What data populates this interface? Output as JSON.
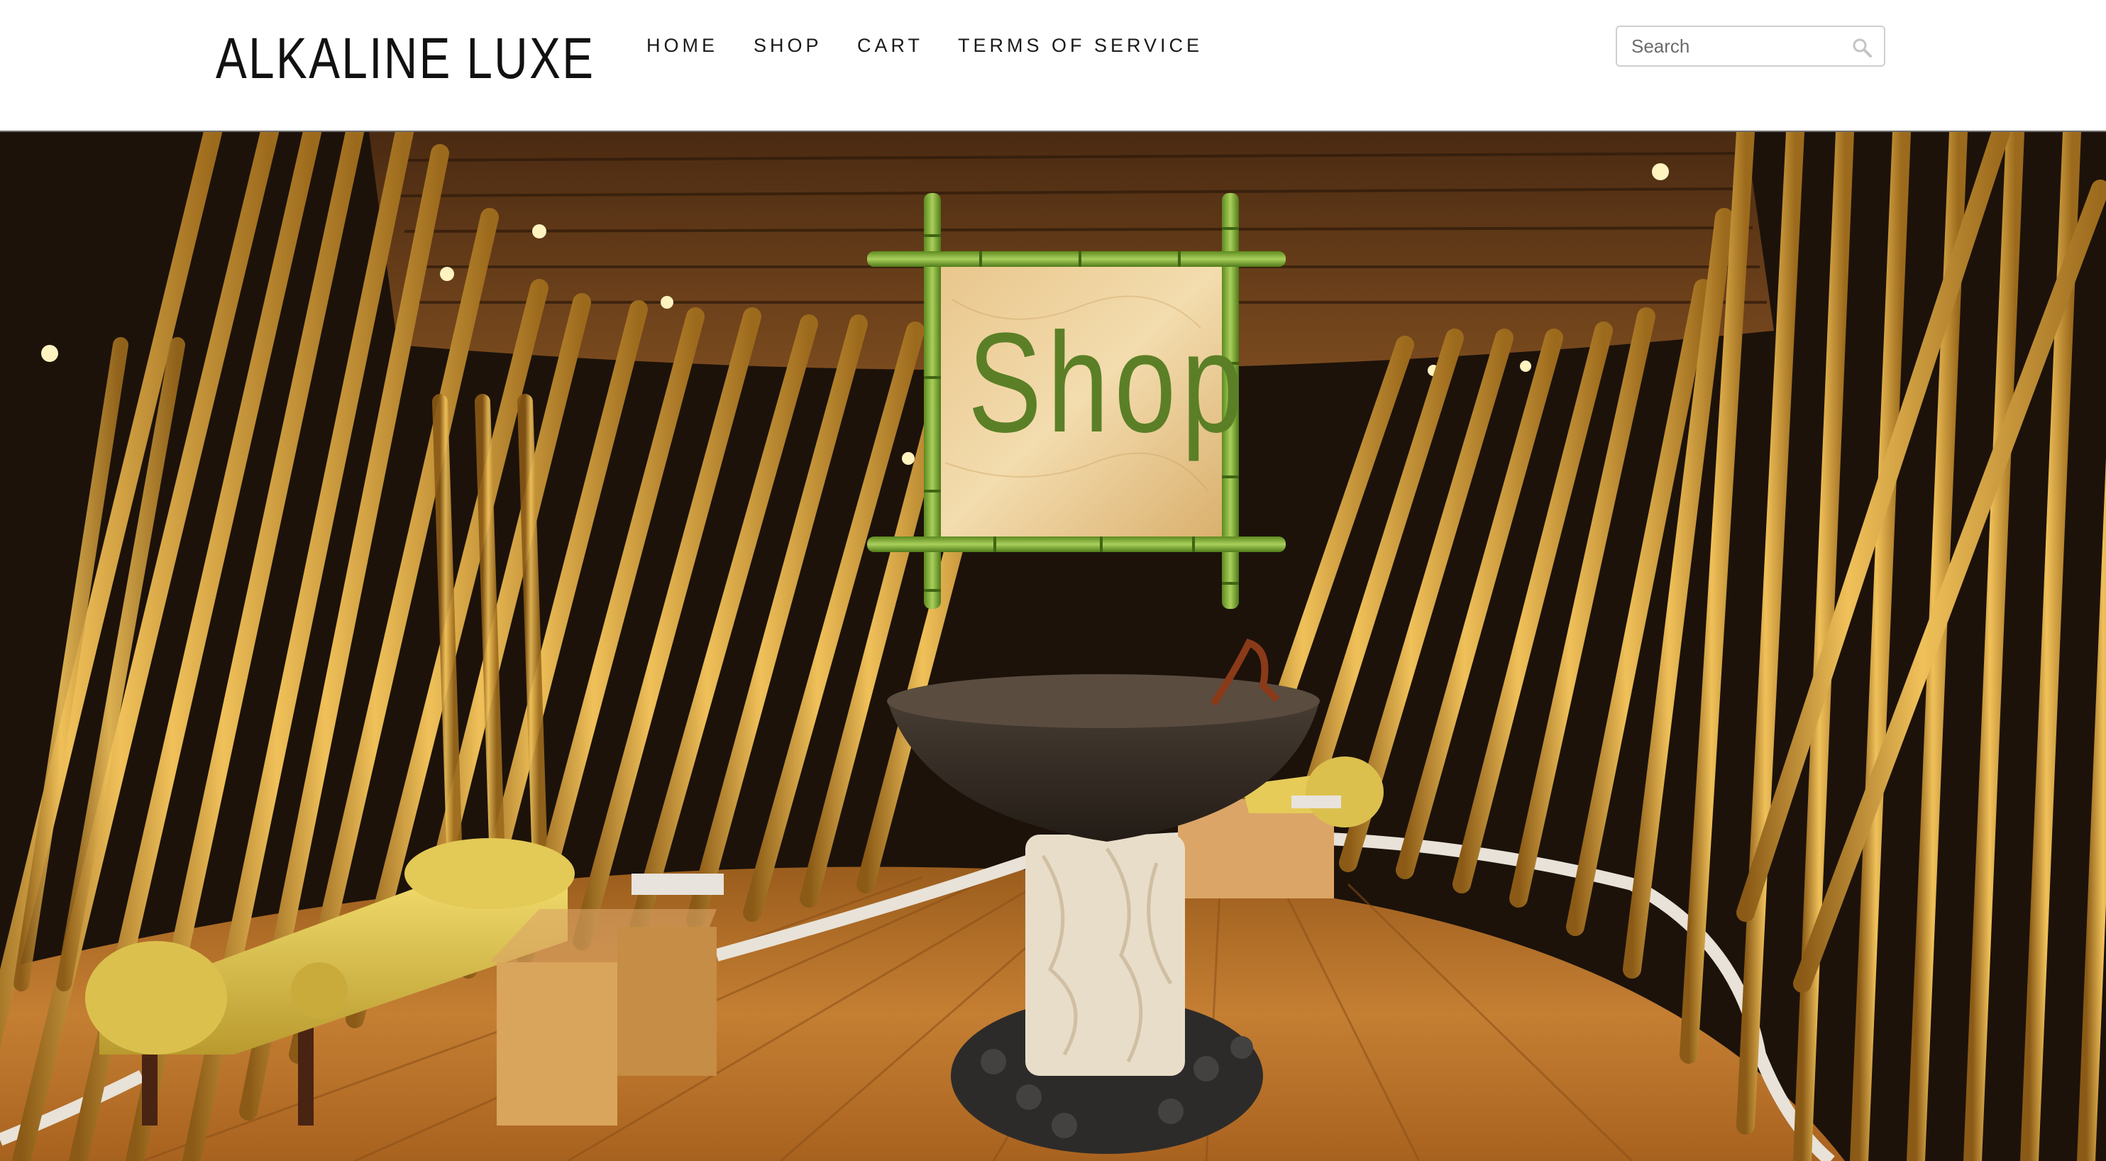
{
  "header": {
    "logo": "ALKALINE LUXE",
    "nav": [
      {
        "label": "HOME"
      },
      {
        "label": "SHOP"
      },
      {
        "label": "CART"
      },
      {
        "label": "TERMS OF SERVICE"
      }
    ],
    "search": {
      "placeholder": "Search",
      "value": "",
      "icon": "search-icon"
    }
  },
  "hero": {
    "sign_text": "Shop",
    "sign_text_color": "#5b7f26",
    "bamboo_color": "#d9a441",
    "floor_color": "#b8752c"
  }
}
